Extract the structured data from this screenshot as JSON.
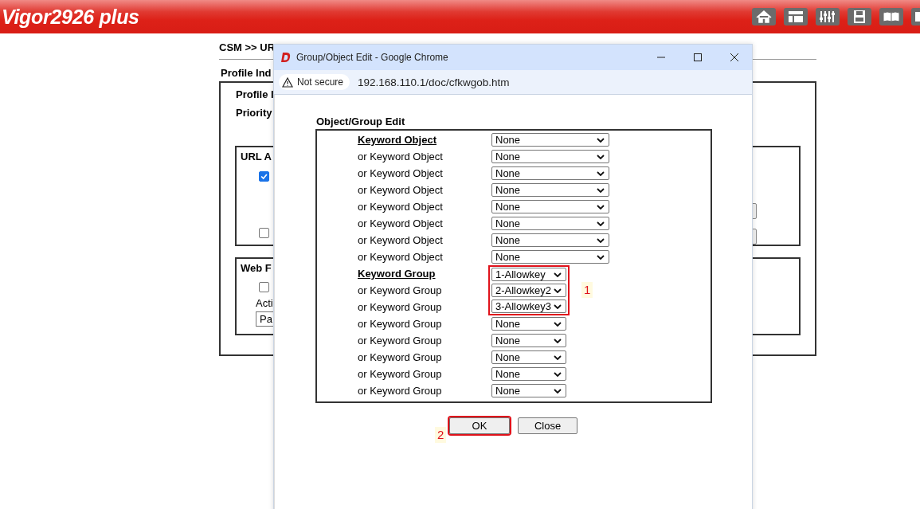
{
  "header": {
    "brand": "Vigor2926 plus"
  },
  "page": {
    "breadcrumb": "CSM >> UR",
    "section_label": "Profile Ind",
    "profile_label": "Profile I",
    "priority_label": "Priority",
    "url_box": {
      "title": "URL A",
      "options": [
        {
          "checked": true
        },
        {
          "checked": false
        }
      ]
    },
    "web_box": {
      "title": "Web F",
      "option": {
        "checked": false
      },
      "action_label": "Acti",
      "action_select": "Pa"
    }
  },
  "popup": {
    "title": "Group/Object Edit - Google Chrome",
    "security": "Not secure",
    "url": "192.168.110.1/doc/cfkwgob.htm",
    "heading": "Object/Group Edit",
    "rows": [
      {
        "kind": "object",
        "label": "Keyword Object",
        "primary": true,
        "value": "None",
        "highlighted": false
      },
      {
        "kind": "object",
        "label": "or Keyword Object",
        "primary": false,
        "value": "None",
        "highlighted": false
      },
      {
        "kind": "object",
        "label": "or Keyword Object",
        "primary": false,
        "value": "None",
        "highlighted": false
      },
      {
        "kind": "object",
        "label": "or Keyword Object",
        "primary": false,
        "value": "None",
        "highlighted": false
      },
      {
        "kind": "object",
        "label": "or Keyword Object",
        "primary": false,
        "value": "None",
        "highlighted": false
      },
      {
        "kind": "object",
        "label": "or Keyword Object",
        "primary": false,
        "value": "None",
        "highlighted": false
      },
      {
        "kind": "object",
        "label": "or Keyword Object",
        "primary": false,
        "value": "None",
        "highlighted": false
      },
      {
        "kind": "object",
        "label": "or Keyword Object",
        "primary": false,
        "value": "None",
        "highlighted": false
      },
      {
        "kind": "group",
        "label": "Keyword Group",
        "primary": true,
        "value": "1-Allowkey",
        "highlighted": true
      },
      {
        "kind": "group",
        "label": "or Keyword Group",
        "primary": false,
        "value": "2-Allowkey2",
        "highlighted": true
      },
      {
        "kind": "group",
        "label": "or Keyword Group",
        "primary": false,
        "value": "3-Allowkey3",
        "highlighted": true
      },
      {
        "kind": "group",
        "label": "or Keyword Group",
        "primary": false,
        "value": "None",
        "highlighted": false
      },
      {
        "kind": "group",
        "label": "or Keyword Group",
        "primary": false,
        "value": "None",
        "highlighted": false
      },
      {
        "kind": "group",
        "label": "or Keyword Group",
        "primary": false,
        "value": "None",
        "highlighted": false
      },
      {
        "kind": "group",
        "label": "or Keyword Group",
        "primary": false,
        "value": "None",
        "highlighted": false
      },
      {
        "kind": "group",
        "label": "or Keyword Group",
        "primary": false,
        "value": "None",
        "highlighted": false
      }
    ],
    "rows_callout": "1",
    "buttons": [
      {
        "label": "OK",
        "highlighted": true,
        "callout": "2"
      },
      {
        "label": "Close",
        "highlighted": false
      }
    ]
  }
}
